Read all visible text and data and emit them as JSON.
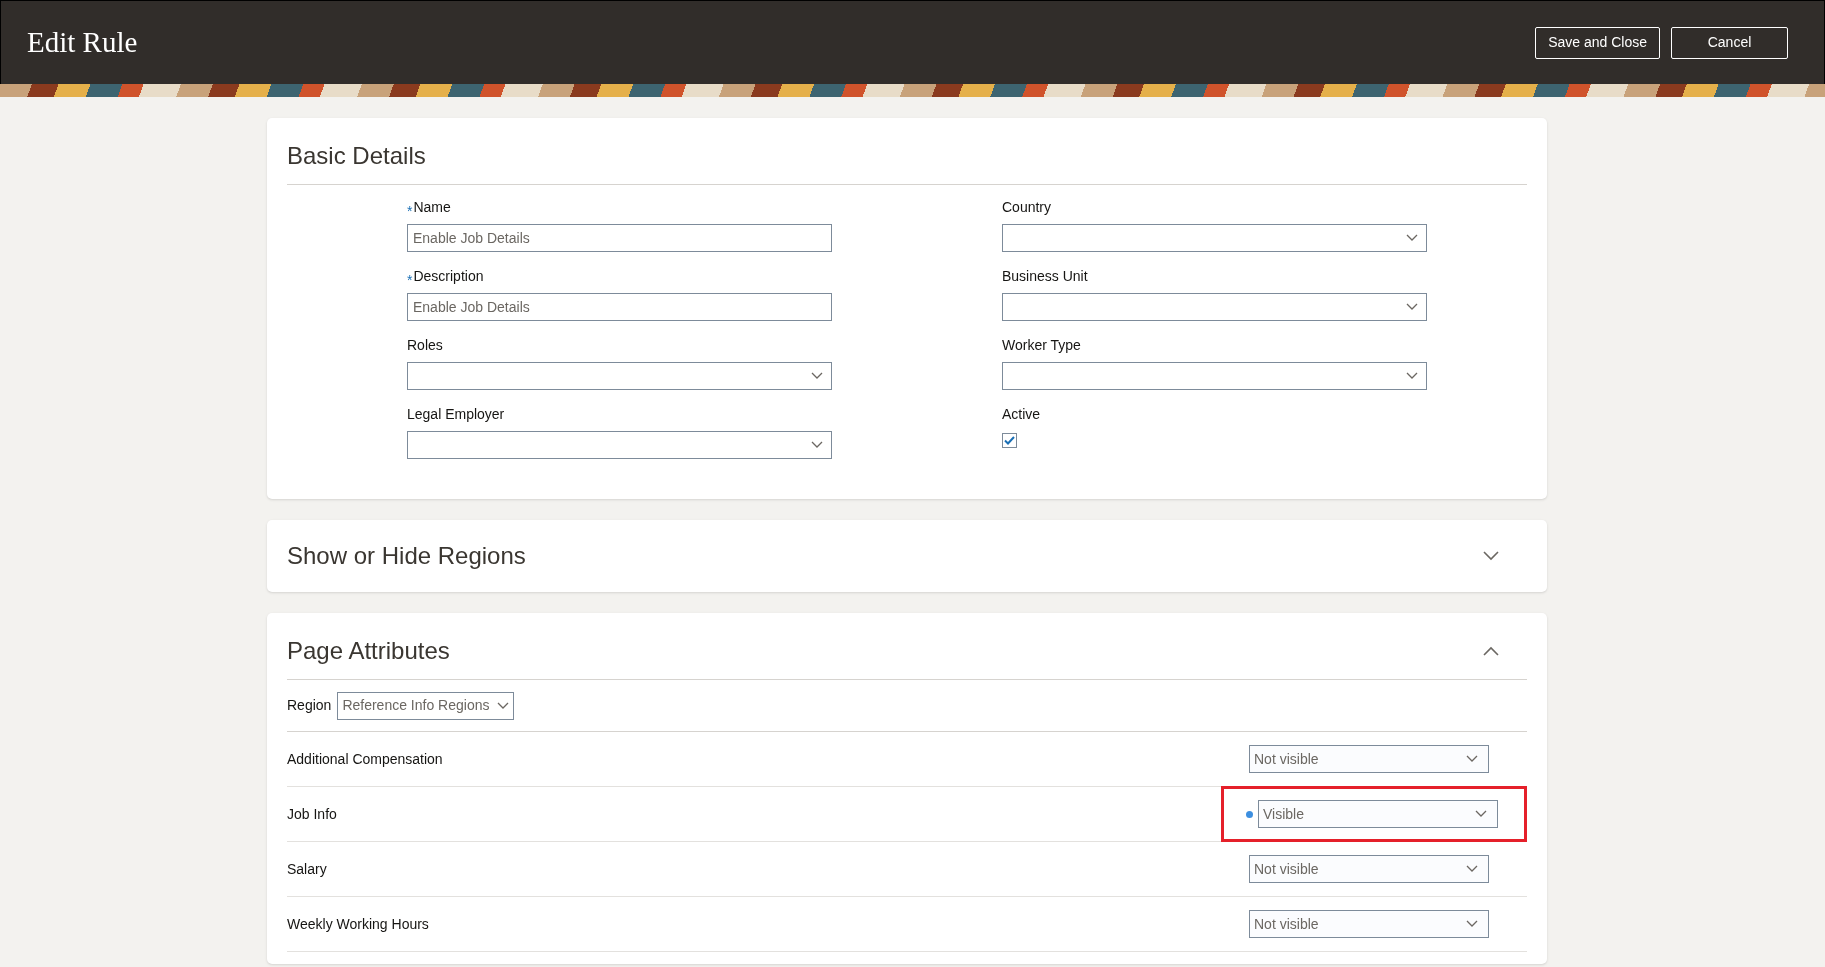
{
  "header": {
    "title": "Edit Rule",
    "buttons": [
      "Save and Close",
      "Cancel"
    ]
  },
  "basic_details": {
    "title": "Basic Details",
    "columns": [
      [
        {
          "kind": "text",
          "label": "Name",
          "required_marker": "*",
          "value": "Enable Job Details"
        },
        {
          "kind": "text",
          "label": "Description",
          "required_marker": "*",
          "value": "Enable Job Details"
        },
        {
          "kind": "select",
          "label": "Roles"
        },
        {
          "kind": "select",
          "label": "Legal Employer"
        }
      ],
      [
        {
          "kind": "select",
          "label": "Country"
        },
        {
          "kind": "select",
          "label": "Business Unit"
        },
        {
          "kind": "select",
          "label": "Worker Type"
        },
        {
          "kind": "checkbox",
          "label": "Active",
          "checked": true
        }
      ]
    ]
  },
  "show_hide_regions": {
    "title": "Show or Hide Regions",
    "expanded": false
  },
  "page_attributes": {
    "title": "Page Attributes",
    "expanded": true,
    "region": {
      "label": "Region",
      "value": "Reference Info Regions"
    },
    "rows": [
      {
        "label": "Additional Compensation",
        "value": "Not visible",
        "modified": false,
        "highlighted": false
      },
      {
        "label": "Job Info",
        "value": "Visible",
        "modified": true,
        "highlighted": true
      },
      {
        "label": "Salary",
        "value": "Not visible",
        "modified": false,
        "highlighted": false
      },
      {
        "label": "Weekly Working Hours",
        "value": "Not visible",
        "modified": false,
        "highlighted": false
      }
    ]
  }
}
